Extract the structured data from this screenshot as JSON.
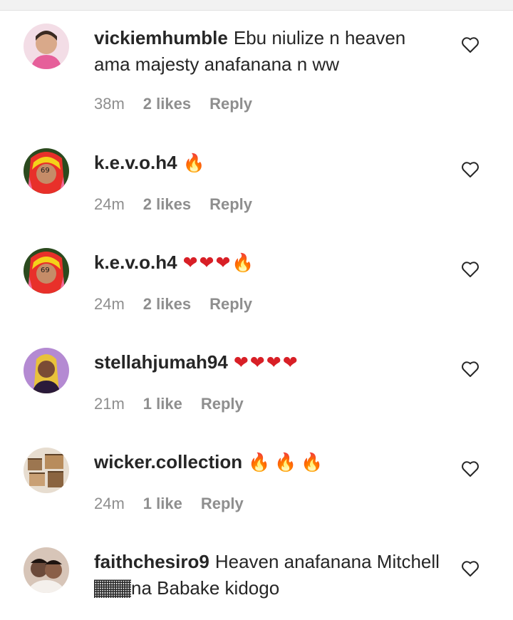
{
  "comments": [
    {
      "username": "vickiemhumble",
      "text": "Ebu niulize n heaven ama majesty anafanana n ww",
      "emoji": "",
      "time": "38m",
      "likes": "2 likes",
      "reply": "Reply",
      "avatar_color": "#f4c9d6",
      "like_icon": "heart-outline-icon"
    },
    {
      "username": "k.e.v.o.h4",
      "text": "",
      "emoji": "🔥",
      "time": "24m",
      "likes": "2 likes",
      "reply": "Reply",
      "avatar_color": "#e23a2a",
      "like_icon": "heart-outline-icon"
    },
    {
      "username": "k.e.v.o.h4",
      "text": "",
      "emoji": "❤❤❤🔥",
      "time": "24m",
      "likes": "2 likes",
      "reply": "Reply",
      "avatar_color": "#e23a2a",
      "like_icon": "heart-outline-icon"
    },
    {
      "username": "stellahjumah94",
      "text": "",
      "emoji": "❤❤❤❤",
      "time": "21m",
      "likes": "1 like",
      "reply": "Reply",
      "avatar_color": "#8a5aa8",
      "like_icon": "heart-outline-icon"
    },
    {
      "username": "wicker.collection",
      "text": "",
      "emoji": "🔥🔥🔥",
      "time": "24m",
      "likes": "1 like",
      "reply": "Reply",
      "avatar_color": "#b89b77",
      "like_icon": "heart-outline-icon"
    },
    {
      "username": "faithchesiro9",
      "text": "Heaven anafanana Mitchell 🏾🏾na Babake kidogo",
      "emoji": "",
      "time": "",
      "likes": "",
      "reply": "",
      "avatar_color": "#6b4a3a",
      "like_icon": "heart-outline-icon"
    }
  ]
}
